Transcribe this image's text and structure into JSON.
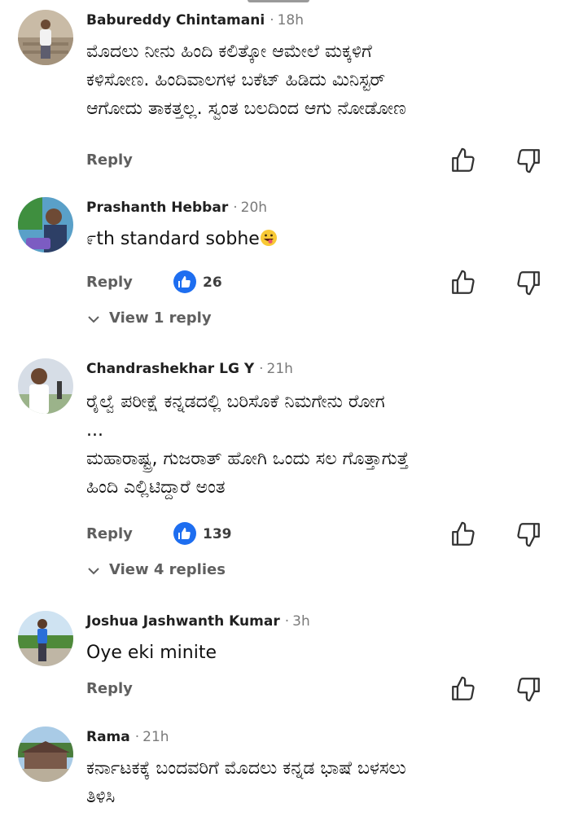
{
  "colors": {
    "like_badge": "#1e6ef0",
    "meta": "#7a7a7a",
    "action": "#5f5f5f"
  },
  "icons": {
    "like": "thumbs-up-icon",
    "dislike": "thumbs-down-icon",
    "expand": "chevron-down-icon"
  },
  "comments": [
    {
      "author": "Babureddy Chintamani",
      "time": "18h",
      "text": "ಮೊದಲು ನೀನು ಹಿಂದಿ ಕಲಿತ್ಕೋ ಆಮೇಲೆ ಮಕ್ಕಳಿಗೆ\nಕಳಿಸೋಣ. ಹಿಂದಿವಾಲಗಳ ಬಕೆಟ್ ಹಿಡಿದು ಮಿನಿಸ್ಟರ್\nಆಗೋದು ತಾಕತ್ತಲ್ಲ. ಸ್ವಂತ ಬಲದಿಂದ ಆಗು ನೋಡೋಣ",
      "reply_label": "Reply"
    },
    {
      "author": "Prashanth Hebbar",
      "time": "20h",
      "text": "೯th standard sobhe",
      "reply_label": "Reply",
      "likes": "26",
      "view_replies": "View 1 reply"
    },
    {
      "author": "Chandrashekhar LG Y",
      "time": "21h",
      "text": "ರೈಲ್ವೆ ಪರೀಕ್ಷೆ ಕನ್ನಡದಲ್ಲಿ ಬರಿಸೊಕೆ ನಿಮಗೇನು ರೋಗ\n...\nಮಹಾರಾಷ್ಟ್ರ, ಗುಜರಾತ್ ಹೋಗಿ ಒಂದು ಸಲ ಗೊತ್ತಾಗುತ್ತೆ\nಹಿಂದಿ ಎಲ್ಲಿಟಿದ್ದಾರೆ ಅಂತ",
      "reply_label": "Reply",
      "likes": "139",
      "view_replies": "View 4 replies"
    },
    {
      "author": "Joshua Jashwanth Kumar",
      "time": "3h",
      "text": "Oye eki minite",
      "reply_label": "Reply"
    },
    {
      "author": "Rama",
      "time": "21h",
      "text": "ಕರ್ನಾಟಕಕ್ಕೆ ಬಂದವರಿಗೆ ಮೊದಲು ಕನ್ನಡ ಭಾಷೆ ಬಳಸಲು\nತಿಳಿಸಿ"
    }
  ]
}
